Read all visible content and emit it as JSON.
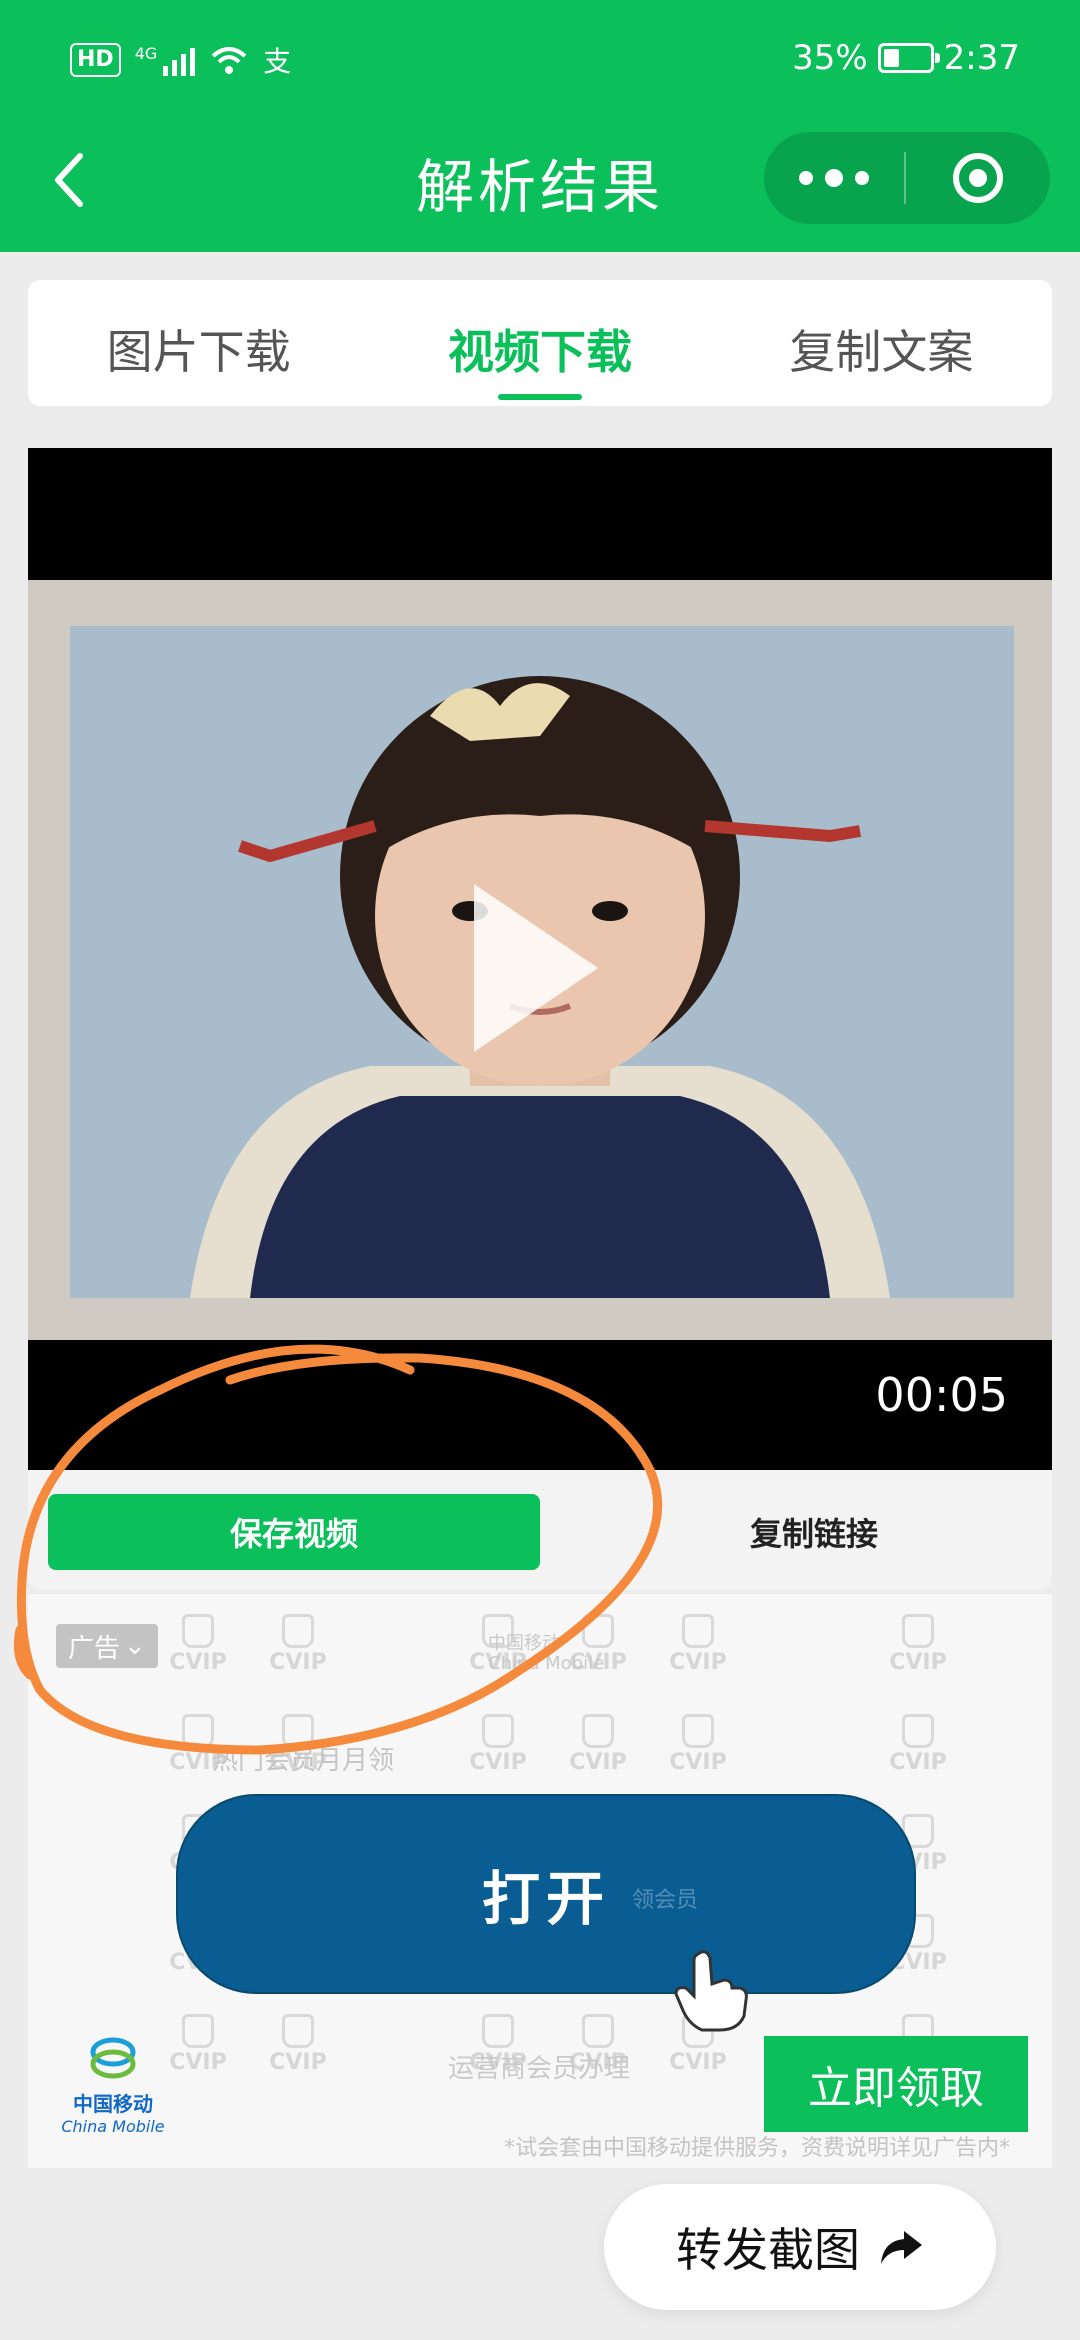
{
  "status_bar": {
    "hd": "HD",
    "network": "4G",
    "carrier_app_icon": "支",
    "battery_percent": "35%",
    "battery_level": 0.35,
    "time": "2:37"
  },
  "title_bar": {
    "title": "解析结果",
    "back_icon": "chevron-left-icon",
    "more_icon": "more-dots-icon",
    "close_icon": "target-circle-icon"
  },
  "tabs": [
    {
      "label": "图片下载",
      "active": false
    },
    {
      "label": "视频下载",
      "active": true
    },
    {
      "label": "复制文案",
      "active": false
    }
  ],
  "video": {
    "duration": "00:05",
    "play_icon": "play-icon"
  },
  "actions": {
    "save_label": "保存视频",
    "copy_label": "复制链接"
  },
  "ad": {
    "badge": "广告",
    "watermark": "CVIP",
    "brand_faint_cn": "中国移动",
    "brand_faint_en": "China Mobile",
    "line1": "热门会员月月领",
    "open_label": "打开",
    "open_sub": "领会员",
    "line2": "运营商会员办理",
    "claim_label": "立即领取",
    "logo_cn": "中国移动",
    "logo_en": "China Mobile",
    "disclaimer": "*试会套由中国移动提供服务，资费说明详见广告内*"
  },
  "forward": {
    "label": "转发截图",
    "icon": "share-arrow-icon"
  },
  "colors": {
    "brand_green": "#0bbf5a",
    "ad_button_blue": "#0a5d92",
    "annotation_orange": "#f58a3c"
  }
}
